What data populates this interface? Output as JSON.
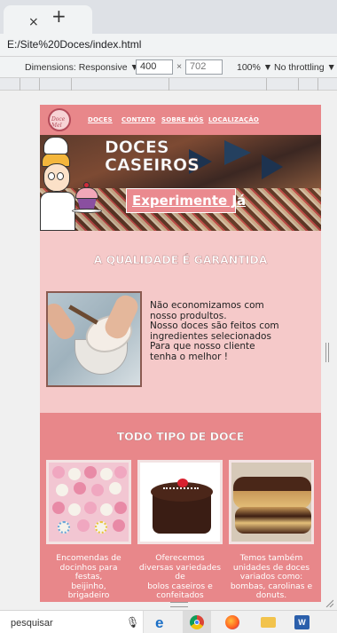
{
  "browser": {
    "tab_close": "×",
    "new_tab": "+",
    "url": "E:/Site%20Doces/index.html"
  },
  "devtools": {
    "dimensions_label": "Dimensions: Responsive ▼",
    "width_value": "400",
    "times": "×",
    "height_value": "702",
    "zoom": "100% ▼",
    "throttling": "No throttling ▼"
  },
  "site": {
    "logo_text": "Doce Mel",
    "nav": [
      "DOCES",
      "CONTATO",
      "SOBRE NÓS",
      "LOCALIZAÇÃO"
    ],
    "hero_title": "DOCES\nCASEIROS",
    "hero_cta": "Experimente Já",
    "quality_title": "A QUALIDADE É GARANTIDA",
    "quality_text": "Não economizamos com\nnosso produltos.\nNosso doces são feitos com\ningredientes selecionados\nPara que nosso cliente\ntenha o melhor !",
    "types_title": "TODO TIPO DE DOCE",
    "cards": [
      "Encomendas de\ndocinhos para\nfestas,\nbeijinho,\nbrigadeiro",
      "Oferecemos\ndiversas variedades\nde\nbolos caseiros e\nconfeitados",
      "Temos também\nunidades de doces\nvariados como:\nbombas, carolinas e\ndonuts."
    ]
  },
  "taskbar": {
    "search_text": "pesquisar",
    "word_label": "W"
  },
  "colors": {
    "nav_bg": "#e8878a",
    "page_bg": "#f5c9c9",
    "accent": "#ea8a8f"
  }
}
